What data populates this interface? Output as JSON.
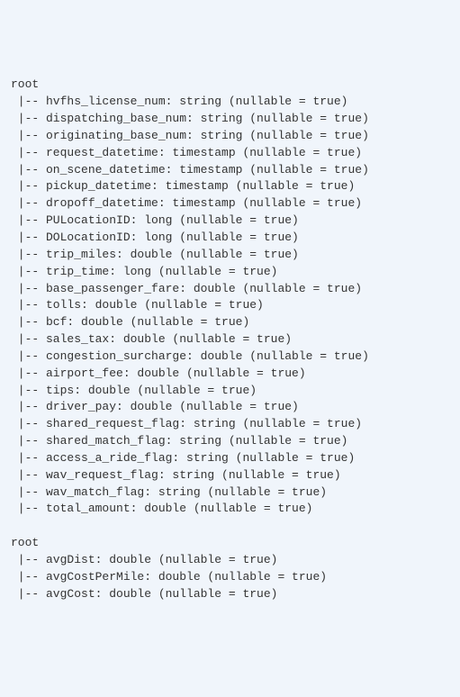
{
  "schemas": [
    {
      "root_label": "root",
      "fields": [
        {
          "name": "hvfhs_license_num",
          "type": "string",
          "nullable": "true"
        },
        {
          "name": "dispatching_base_num",
          "type": "string",
          "nullable": "true"
        },
        {
          "name": "originating_base_num",
          "type": "string",
          "nullable": "true"
        },
        {
          "name": "request_datetime",
          "type": "timestamp",
          "nullable": "true"
        },
        {
          "name": "on_scene_datetime",
          "type": "timestamp",
          "nullable": "true"
        },
        {
          "name": "pickup_datetime",
          "type": "timestamp",
          "nullable": "true"
        },
        {
          "name": "dropoff_datetime",
          "type": "timestamp",
          "nullable": "true"
        },
        {
          "name": "PULocationID",
          "type": "long",
          "nullable": "true"
        },
        {
          "name": "DOLocationID",
          "type": "long",
          "nullable": "true"
        },
        {
          "name": "trip_miles",
          "type": "double",
          "nullable": "true"
        },
        {
          "name": "trip_time",
          "type": "long",
          "nullable": "true"
        },
        {
          "name": "base_passenger_fare",
          "type": "double",
          "nullable": "true"
        },
        {
          "name": "tolls",
          "type": "double",
          "nullable": "true"
        },
        {
          "name": "bcf",
          "type": "double",
          "nullable": "true"
        },
        {
          "name": "sales_tax",
          "type": "double",
          "nullable": "true"
        },
        {
          "name": "congestion_surcharge",
          "type": "double",
          "nullable": "true"
        },
        {
          "name": "airport_fee",
          "type": "double",
          "nullable": "true"
        },
        {
          "name": "tips",
          "type": "double",
          "nullable": "true"
        },
        {
          "name": "driver_pay",
          "type": "double",
          "nullable": "true"
        },
        {
          "name": "shared_request_flag",
          "type": "string",
          "nullable": "true"
        },
        {
          "name": "shared_match_flag",
          "type": "string",
          "nullable": "true"
        },
        {
          "name": "access_a_ride_flag",
          "type": "string",
          "nullable": "true"
        },
        {
          "name": "wav_request_flag",
          "type": "string",
          "nullable": "true"
        },
        {
          "name": "wav_match_flag",
          "type": "string",
          "nullable": "true"
        },
        {
          "name": "total_amount",
          "type": "double",
          "nullable": "true"
        }
      ]
    },
    {
      "root_label": "root",
      "fields": [
        {
          "name": "avgDist",
          "type": "double",
          "nullable": "true"
        },
        {
          "name": "avgCostPerMile",
          "type": "double",
          "nullable": "true"
        },
        {
          "name": "avgCost",
          "type": "double",
          "nullable": "true"
        }
      ]
    }
  ]
}
